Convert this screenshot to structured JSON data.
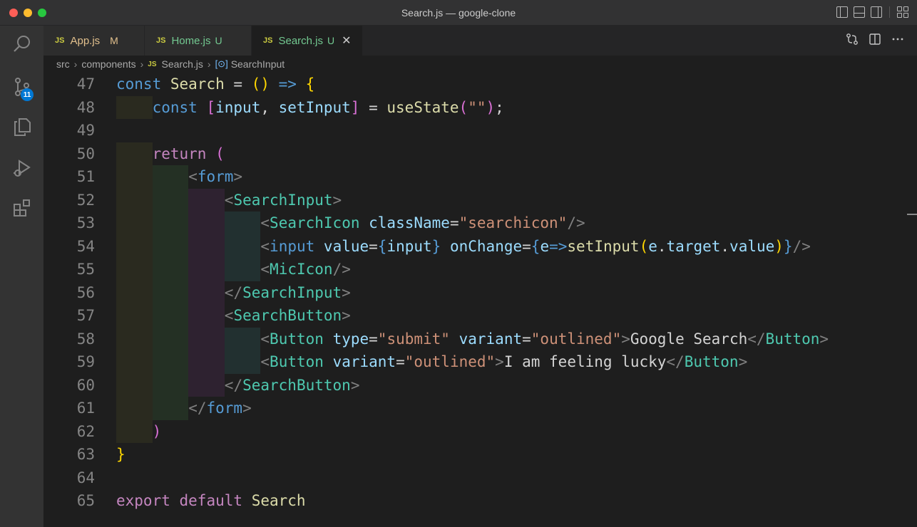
{
  "window": {
    "title": "Search.js — google-clone"
  },
  "activity_bar": {
    "items": [
      {
        "icon": "explorer-search-icon"
      },
      {
        "icon": "source-control-icon",
        "badge": "11"
      },
      {
        "icon": "files-icon"
      },
      {
        "icon": "run-debug-icon"
      },
      {
        "icon": "extensions-icon"
      }
    ]
  },
  "tabs": [
    {
      "label": "App.js",
      "status": "M",
      "color": "#e2c08d",
      "active": false
    },
    {
      "label": "Home.js",
      "status": "U",
      "color": "#73c991",
      "active": false
    },
    {
      "label": "Search.js",
      "status": "U",
      "color": "#73c991",
      "active": true
    }
  ],
  "tab_file_icon_label": "JS",
  "breadcrumb": {
    "parts": [
      "src",
      "components",
      "Search.js",
      "SearchInput"
    ]
  },
  "editor": {
    "line_numbers": [
      "47",
      "48",
      "49",
      "50",
      "51",
      "52",
      "53",
      "54",
      "55",
      "56",
      "57",
      "58",
      "59",
      "60",
      "61",
      "62",
      "63",
      "64",
      "65"
    ],
    "lines": [
      [
        [
          "kw",
          "const"
        ],
        [
          "txt",
          " "
        ],
        [
          "fn",
          "Search"
        ],
        [
          "txt",
          " = "
        ],
        [
          "b1",
          "()"
        ],
        [
          "txt",
          " "
        ],
        [
          "kw",
          "=>"
        ],
        [
          "txt",
          " "
        ],
        [
          "b1",
          "{"
        ]
      ],
      [
        [
          "kw",
          "const"
        ],
        [
          "txt",
          " "
        ],
        [
          "b2",
          "["
        ],
        [
          "var",
          "input"
        ],
        [
          "txt",
          ", "
        ],
        [
          "var",
          "setInput"
        ],
        [
          "b2",
          "]"
        ],
        [
          "txt",
          " = "
        ],
        [
          "fn",
          "useState"
        ],
        [
          "b2",
          "("
        ],
        [
          "str",
          "\"\""
        ],
        [
          "b2",
          ")"
        ],
        [
          "txt",
          ";"
        ]
      ],
      [],
      [
        [
          "ctl",
          "return"
        ],
        [
          "txt",
          " "
        ],
        [
          "b2",
          "("
        ]
      ],
      [
        [
          "pun",
          "<"
        ],
        [
          "htag",
          "form"
        ],
        [
          "pun",
          ">"
        ]
      ],
      [
        [
          "pun",
          "<"
        ],
        [
          "tag",
          "SearchInput"
        ],
        [
          "pun",
          ">"
        ]
      ],
      [
        [
          "pun",
          "<"
        ],
        [
          "tag",
          "SearchIcon"
        ],
        [
          "txt",
          " "
        ],
        [
          "attr",
          "className"
        ],
        [
          "txt",
          "="
        ],
        [
          "str",
          "\"searchicon\""
        ],
        [
          "pun",
          "/>"
        ]
      ],
      [
        [
          "pun",
          "<"
        ],
        [
          "htag",
          "input"
        ],
        [
          "txt",
          " "
        ],
        [
          "attr",
          "value"
        ],
        [
          "txt",
          "="
        ],
        [
          "kw",
          "{"
        ],
        [
          "var",
          "input"
        ],
        [
          "kw",
          "}"
        ],
        [
          "txt",
          " "
        ],
        [
          "attr",
          "onChange"
        ],
        [
          "txt",
          "="
        ],
        [
          "kw",
          "{"
        ],
        [
          "var",
          "e"
        ],
        [
          "kw",
          "=>"
        ],
        [
          "fn",
          "setInput"
        ],
        [
          "b1",
          "("
        ],
        [
          "var",
          "e"
        ],
        [
          "txt",
          "."
        ],
        [
          "var",
          "target"
        ],
        [
          "txt",
          "."
        ],
        [
          "var",
          "value"
        ],
        [
          "b1",
          ")"
        ],
        [
          "kw",
          "}"
        ],
        [
          "pun",
          "/>"
        ]
      ],
      [
        [
          "pun",
          "<"
        ],
        [
          "tag",
          "MicIcon"
        ],
        [
          "pun",
          "/>"
        ]
      ],
      [
        [
          "pun",
          "</"
        ],
        [
          "tag",
          "SearchInput"
        ],
        [
          "pun",
          ">"
        ]
      ],
      [
        [
          "pun",
          "<"
        ],
        [
          "tag",
          "SearchButton"
        ],
        [
          "pun",
          ">"
        ]
      ],
      [
        [
          "pun",
          "<"
        ],
        [
          "tag",
          "Button"
        ],
        [
          "txt",
          " "
        ],
        [
          "attr",
          "type"
        ],
        [
          "txt",
          "="
        ],
        [
          "str",
          "\"submit\""
        ],
        [
          "txt",
          " "
        ],
        [
          "attr",
          "variant"
        ],
        [
          "txt",
          "="
        ],
        [
          "str",
          "\"outlined\""
        ],
        [
          "pun",
          ">"
        ],
        [
          "txt",
          "Google Search"
        ],
        [
          "pun",
          "</"
        ],
        [
          "tag",
          "Button"
        ],
        [
          "pun",
          ">"
        ]
      ],
      [
        [
          "pun",
          "<"
        ],
        [
          "tag",
          "Button"
        ],
        [
          "txt",
          " "
        ],
        [
          "attr",
          "variant"
        ],
        [
          "txt",
          "="
        ],
        [
          "str",
          "\"outlined\""
        ],
        [
          "pun",
          ">"
        ],
        [
          "txt",
          "I am feeling lucky"
        ],
        [
          "pun",
          "</"
        ],
        [
          "tag",
          "Button"
        ],
        [
          "pun",
          ">"
        ]
      ],
      [
        [
          "pun",
          "</"
        ],
        [
          "tag",
          "SearchButton"
        ],
        [
          "pun",
          ">"
        ]
      ],
      [
        [
          "pun",
          "</"
        ],
        [
          "htag",
          "form"
        ],
        [
          "pun",
          ">"
        ]
      ],
      [
        [
          "b2",
          ")"
        ]
      ],
      [
        [
          "b1",
          "}"
        ]
      ],
      [],
      [
        [
          "ctl",
          "export"
        ],
        [
          "txt",
          " "
        ],
        [
          "ctl",
          "default"
        ],
        [
          "txt",
          " "
        ],
        [
          "fn",
          "Search"
        ]
      ]
    ]
  }
}
